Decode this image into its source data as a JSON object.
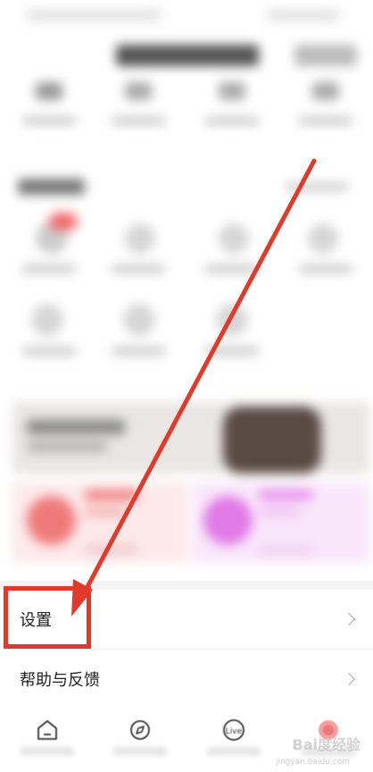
{
  "menu": {
    "settings_label": "设置",
    "help_label": "帮助与反馈"
  },
  "bottom_nav": {
    "items": [
      {
        "icon": "home-icon"
      },
      {
        "icon": "compass-icon"
      },
      {
        "icon": "live-icon",
        "text": "Live"
      },
      {
        "icon": "profile-icon"
      }
    ]
  },
  "watermark": {
    "text": "Bai度经验",
    "sub": "jingyan.baidu.com"
  },
  "colors": {
    "annotation_red": "#e23a2a",
    "accent_pink": "#f06a6a",
    "accent_purple": "#e07ae6"
  }
}
